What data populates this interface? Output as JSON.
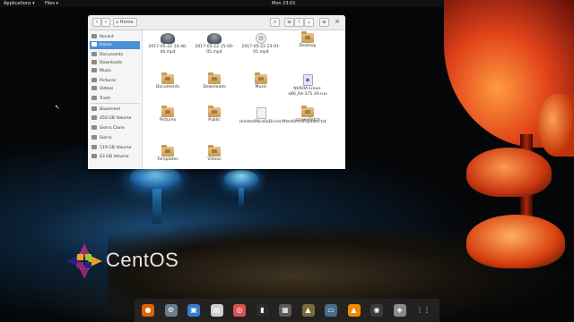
{
  "top_panel": {
    "applications": "Applications ▾",
    "places": "Files ▾",
    "clock": "Mon 23:01",
    "tray": "⚙ ▾"
  },
  "file_manager": {
    "location": "Home",
    "sidebar": [
      {
        "label": "Recent",
        "icon": "clock-icon",
        "active": false
      },
      {
        "label": "Home",
        "icon": "home-icon",
        "active": true
      },
      {
        "label": "Documents",
        "icon": "documents-icon",
        "active": false
      },
      {
        "label": "Downloads",
        "icon": "downloads-icon",
        "active": false
      },
      {
        "label": "Music",
        "icon": "music-icon",
        "active": false
      },
      {
        "label": "Pictures",
        "icon": "pictures-icon",
        "active": false
      },
      {
        "label": "Videos",
        "icon": "videos-icon",
        "active": false
      },
      {
        "label": "Trash",
        "icon": "trash-icon",
        "active": false
      },
      {
        "label": "Basement",
        "icon": "drive-icon",
        "active": false
      },
      {
        "label": "450 GB Volume",
        "icon": "drive-icon",
        "active": false
      },
      {
        "label": "Sierra Clone",
        "icon": "drive-icon",
        "active": false
      },
      {
        "label": "Sierra",
        "icon": "drive-icon",
        "active": false
      },
      {
        "label": "119 GB Volume",
        "icon": "drive-icon",
        "active": false
      },
      {
        "label": "63 GB Volume",
        "icon": "drive-icon",
        "active": false
      }
    ],
    "files": [
      {
        "name": "2017-05-22 14-46-44.mp4",
        "kind": "video"
      },
      {
        "name": "2017-05-22 15-00-05.mp4",
        "kind": "video"
      },
      {
        "name": "2017-05-22 23-01-01.mp4",
        "kind": "gear"
      },
      {
        "name": "Desktop",
        "kind": "folder"
      },
      {
        "name": "Documents",
        "kind": "folder"
      },
      {
        "name": "Downloads",
        "kind": "folder"
      },
      {
        "name": "Music",
        "kind": "folder"
      },
      {
        "name": "NVIDIA-Linux-x86_64-375.39.run",
        "kind": "run"
      },
      {
        "name": "Pictures",
        "kind": "folder"
      },
      {
        "name": "Public",
        "kind": "folder"
      },
      {
        "name": "reinstallNvidiaDriverAfterKernelUpdate.txt",
        "kind": "doc"
      },
      {
        "name": "screenFetch",
        "kind": "folder"
      },
      {
        "name": "Templates",
        "kind": "folder"
      },
      {
        "name": "Videos",
        "kind": "folder"
      }
    ]
  },
  "branding": {
    "os_name": "CentOS"
  },
  "dock": [
    {
      "name": "firefox-icon",
      "glyph": "●",
      "color": "#e66000"
    },
    {
      "name": "settings-icon",
      "glyph": "⚙",
      "color": "#6b7b8c"
    },
    {
      "name": "software-icon",
      "glyph": "▣",
      "color": "#3a7bc8"
    },
    {
      "name": "text-editor-icon",
      "glyph": "▤",
      "color": "#cfcfcf"
    },
    {
      "name": "help-icon",
      "glyph": "◎",
      "color": "#d9534f"
    },
    {
      "name": "terminal-icon",
      "glyph": "▮",
      "color": "#2b2b2b"
    },
    {
      "name": "system-monitor-icon",
      "glyph": "▦",
      "color": "#5a5a5a"
    },
    {
      "name": "image-viewer-icon",
      "glyph": "▲",
      "color": "#7a6a3a"
    },
    {
      "name": "remote-desktop-icon",
      "glyph": "▭",
      "color": "#4a6a8a"
    },
    {
      "name": "vlc-icon",
      "glyph": "▲",
      "color": "#f08a00"
    },
    {
      "name": "obs-icon",
      "glyph": "◉",
      "color": "#3a3a3a"
    },
    {
      "name": "disks-icon",
      "glyph": "◈",
      "color": "#8a8a8a"
    },
    {
      "name": "show-apps-icon",
      "glyph": "⋮⋮",
      "color": "transparent"
    }
  ]
}
